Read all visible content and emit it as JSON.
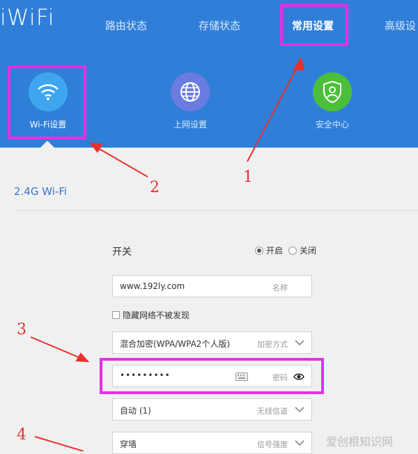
{
  "header": {
    "logo": "iWiFi",
    "nav": [
      "路由状态",
      "存储状态",
      "常用设置",
      "高级设"
    ],
    "active_nav": "常用设置",
    "sub_items": [
      {
        "label": "Wi-Fi设置",
        "icon": "wifi-icon",
        "color": "#3ea6ee"
      },
      {
        "label": "上网设置",
        "icon": "globe-icon",
        "color": "#6a7ce0"
      },
      {
        "label": "安全中心",
        "icon": "shield-user-icon",
        "color": "#4bbf3a"
      }
    ]
  },
  "section": {
    "title": "2.4G Wi-Fi"
  },
  "form": {
    "switch_label": "开关",
    "radio_on": "开启",
    "radio_off": "关闭",
    "ssid_value": "www.192ly.com",
    "ssid_hint": "名称",
    "hide_label": "隐藏网络不被发现",
    "encryption_value": "混合加密(WPA/WPA2个人版)",
    "encryption_hint": "加密方式",
    "password_value": "•••••••••",
    "password_hint": "密码",
    "channel_value": "自动 (1)",
    "channel_hint": "无线信道",
    "signal_value": "穿墙",
    "signal_hint": "信号强度"
  },
  "annotations": [
    "1",
    "2",
    "3",
    "4"
  ],
  "watermark": "爱创根知识网",
  "colors": {
    "header": "#2f7fd9",
    "highlight": "#e52fe5",
    "arrow": "#e8302f"
  }
}
